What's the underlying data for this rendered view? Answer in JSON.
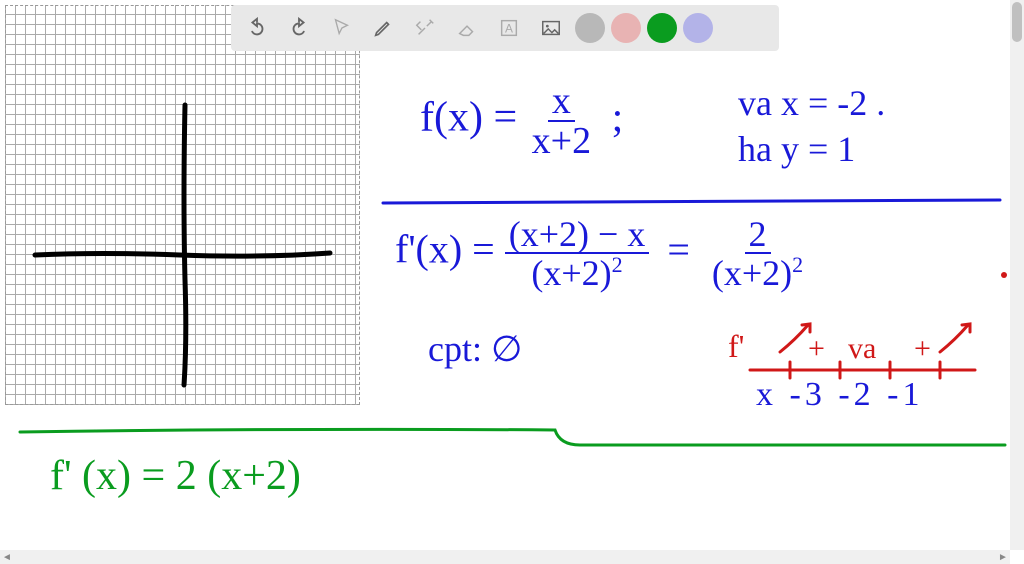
{
  "toolbar": {
    "undo": "undo",
    "redo": "redo",
    "select": "select",
    "pencil": "pencil",
    "tools": "tools",
    "eraser": "eraser",
    "text": "text",
    "image": "image",
    "colors": {
      "gray": "#b8b8b8",
      "pink": "#e8b3b3",
      "green": "#0a9c1f",
      "lavender": "#b3b3e8"
    }
  },
  "math": {
    "line1_lhs": "f(x) =",
    "line1_num": "x",
    "line1_den": "x+2",
    "line1_sep": ";",
    "line1_va": "va x = -2 .",
    "line1_ha": "ha y = 1",
    "line2_lhs": "f'(x) =",
    "line2_num": "(x+2) − x",
    "line2_den": "(x+2)",
    "line2_denexp": "2",
    "line2_eq": "=",
    "line2_num2": "2",
    "line2_den2": "(x+2)",
    "line2_den2exp": "2",
    "cpt": "cpt: ∅",
    "fprime_label": "f'",
    "signs_plus1": "+",
    "signs_va": "va",
    "signs_plus2": "+",
    "xvals": "x -3 -2 -1",
    "green_line": "f' (x) = 2 (x+2)"
  }
}
